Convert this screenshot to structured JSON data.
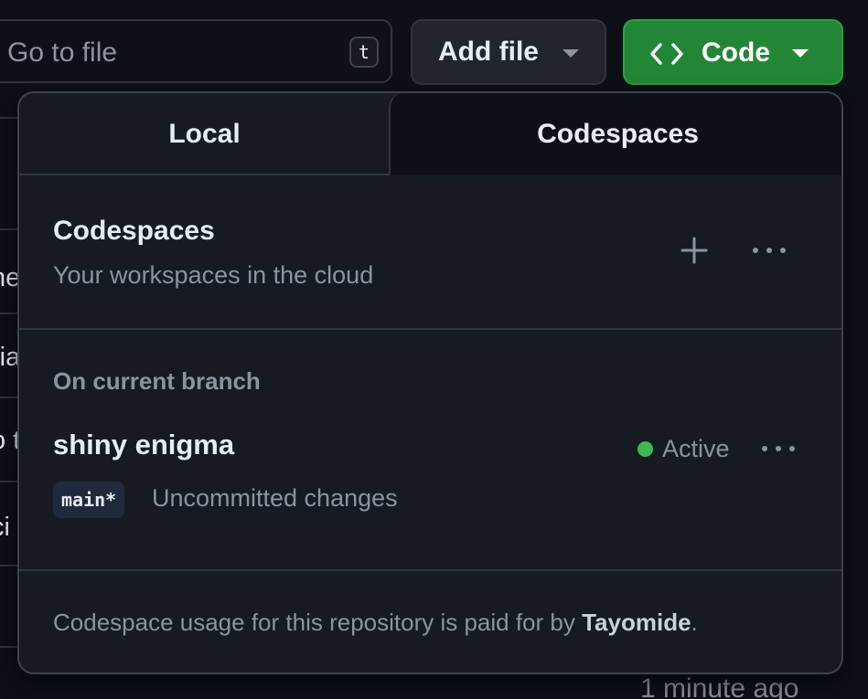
{
  "toolbar": {
    "goto_placeholder": "Go to file",
    "goto_shortcut": "t",
    "add_file_label": "Add file",
    "code_label": "Code"
  },
  "background": {
    "row_fragments": [
      "ne",
      "ria",
      "o t",
      "ci"
    ],
    "timestamp": "1 minute ago"
  },
  "dropdown": {
    "tabs": [
      {
        "label": "Local",
        "selected": false
      },
      {
        "label": "Codespaces",
        "selected": true
      }
    ],
    "section_title": "Codespaces",
    "section_subtitle": "Your workspaces in the cloud",
    "group_label": "On current branch",
    "codespace": {
      "name": "shiny enigma",
      "status": "Active",
      "branch": "main*",
      "changes": "Uncommitted changes"
    },
    "footer": {
      "prefix": "Codespace usage for this repository is paid for by ",
      "owner": "Tayomide",
      "suffix": "."
    }
  },
  "colors": {
    "background": "#0d1117",
    "panel": "#161b22",
    "code_button": "#238636",
    "active_dot": "#3fb950"
  },
  "icons": {
    "code": "code-brackets-icon",
    "plus": "plus-icon",
    "more": "kebab-horizontal-icon",
    "caret": "triangle-down-icon"
  }
}
